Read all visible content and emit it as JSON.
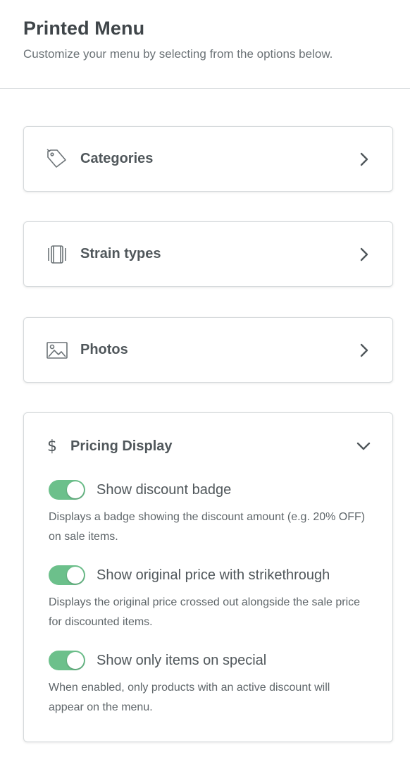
{
  "header": {
    "title": "Printed Menu",
    "subtitle": "Customize your menu by selecting from the options below."
  },
  "sections": [
    {
      "label": "Categories",
      "icon": "tag-icon",
      "expanded": false
    },
    {
      "label": "Strain types",
      "icon": "strain-types-icon",
      "expanded": false
    },
    {
      "label": "Photos",
      "icon": "photo-icon",
      "expanded": false
    }
  ],
  "pricing": {
    "symbol": "$",
    "label": "Pricing Display",
    "expanded": true,
    "options": [
      {
        "label": "Show discount badge",
        "description": "Displays a badge showing the discount amount (e.g. 20% OFF) on sale items.",
        "enabled": true
      },
      {
        "label": "Show original price with strikethrough",
        "description": "Displays the original price crossed out alongside the sale price for discounted items.",
        "enabled": true
      },
      {
        "label": "Show only items on special",
        "description": "When enabled, only products with an active discount will appear on the menu.",
        "enabled": true
      }
    ]
  },
  "colors": {
    "toggle_on": "#6cc08b",
    "text": "#50575b",
    "border": "#d6dadc"
  }
}
